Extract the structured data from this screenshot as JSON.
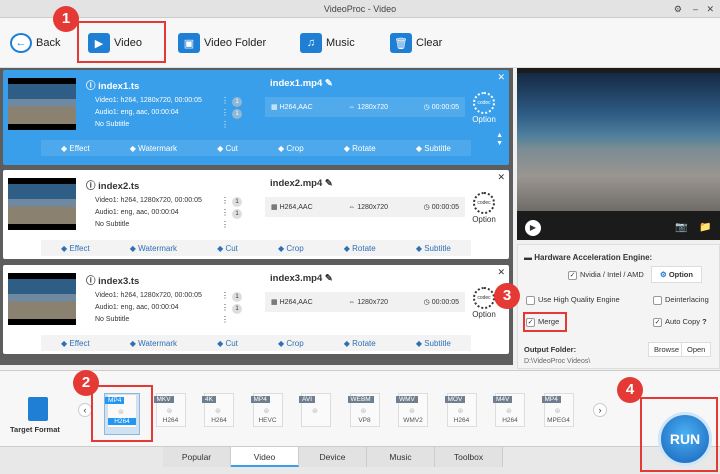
{
  "window": {
    "title": "VideoProc - Video"
  },
  "toolbar": {
    "back": "Back",
    "video": "Video",
    "video_folder": "Video Folder",
    "music": "Music",
    "clear": "Clear"
  },
  "items": [
    {
      "source": "index1.ts",
      "video": "Video1: h264, 1280x720, 00:00:05",
      "audio": "Audio1: eng, aac, 00:00:04",
      "subtitle": "No Subtitle",
      "video_count": "1",
      "audio_count": "1",
      "output": "index1.mp4",
      "codec": "H264,AAC",
      "resolution": "1280x720",
      "duration": "00:00:05"
    },
    {
      "source": "index2.ts",
      "video": "Video1: h264, 1280x720, 00:00:05",
      "audio": "Audio1: eng, aac, 00:00:04",
      "subtitle": "No Subtitle",
      "video_count": "1",
      "audio_count": "1",
      "output": "index2.mp4",
      "codec": "H264,AAC",
      "resolution": "1280x720",
      "duration": "00:00:05"
    },
    {
      "source": "index3.ts",
      "video": "Video1: h264, 1280x720, 00:00:05",
      "audio": "Audio1: eng, aac, 00:00:04",
      "subtitle": "No Subtitle",
      "video_count": "1",
      "audio_count": "1",
      "output": "index3.mp4",
      "codec": "H264,AAC",
      "resolution": "1280x720",
      "duration": "00:00:05"
    }
  ],
  "item_actions": {
    "effect": "Effect",
    "watermark": "Watermark",
    "cut": "Cut",
    "crop": "Crop",
    "rotate": "Rotate",
    "subtitle": "Subtitle",
    "option": "Option",
    "codec_icon": "codec"
  },
  "settings": {
    "hw_title": "Hardware Acceleration Engine:",
    "hw_vendor": "Nvidia / Intel / AMD",
    "option": "Option",
    "high_quality": "Use High Quality Engine",
    "deinterlacing": "Deinterlacing",
    "merge": "Merge",
    "auto_copy": "Auto Copy",
    "help": "?",
    "output_label": "Output Folder:",
    "browse": "Browse",
    "open": "Open",
    "output_path": "D:\\VideoProc Videos\\"
  },
  "target_format": "Target Format",
  "formats": [
    {
      "tag": "MP4",
      "sub": "H264"
    },
    {
      "tag": "MKV",
      "sub": "H264"
    },
    {
      "tag": "4K",
      "sub": "H264"
    },
    {
      "tag": "MP4",
      "sub": "HEVC"
    },
    {
      "tag": "AVI",
      "sub": ""
    },
    {
      "tag": "WEBM",
      "sub": "VP8"
    },
    {
      "tag": "WMV",
      "sub": "WMV2"
    },
    {
      "tag": "MOV",
      "sub": "H264"
    },
    {
      "tag": "M4V",
      "sub": "H264"
    },
    {
      "tag": "MP4",
      "sub": "MPEG4"
    }
  ],
  "tabs": [
    "Popular",
    "Video",
    "Device",
    "Music",
    "Toolbox"
  ],
  "run": "RUN",
  "annotations": [
    "1",
    "2",
    "3",
    "4"
  ],
  "colors": {
    "accent": "#3a9fea",
    "annotation": "#e53935"
  }
}
